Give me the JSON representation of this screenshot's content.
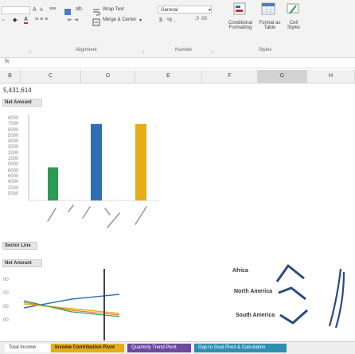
{
  "ribbon": {
    "font": {
      "grow_label": "A",
      "shrink_label": "A",
      "font_color_label": "A"
    },
    "alignment": {
      "wrap_text": "Wrap Text",
      "merge_center": "Merge & Center",
      "group_label": "Alignment"
    },
    "number": {
      "format_value": "General",
      "symbols": "$ · % ,",
      "group_label": "Number"
    },
    "styles": {
      "conditional_formatting": "Conditional Formatting",
      "format_as_table": "Format as Table",
      "cell_styles": "Cell Styles",
      "group_label": "Styles"
    }
  },
  "formula_bar": {
    "fx_label": "fx"
  },
  "columns": [
    "B",
    "C",
    "D",
    "E",
    "F",
    "G",
    "H"
  ],
  "selected_column": "G",
  "cells": {
    "b2_value": "5,431,614",
    "net_amount_header": "Net Amount",
    "sector_line_header": "Sector Line",
    "net_amount_header_2": "Net Amount"
  },
  "region_labels": [
    "Africa",
    "North America",
    "South America"
  ],
  "bar_chart": {
    "bars": [
      {
        "color": "#2e9b54",
        "value": 32
      },
      {
        "color": "#2f6eb5",
        "value": 74
      },
      {
        "color": "#e5ad19",
        "value": 74
      }
    ],
    "ymax": 80
  },
  "colors": {
    "green": "#2e9b54",
    "blue": "#2f6eb5",
    "gold": "#e5ad19",
    "navy": "#2b4b80",
    "purple": "#6b4aa0",
    "teal": "#2f8fb0"
  },
  "sheet_tabs": [
    {
      "label": "Total Income",
      "active": true
    },
    {
      "label": "Income Contribution Pivot",
      "active": false
    },
    {
      "label": "Quarterly Trend Pivot",
      "active": false
    },
    {
      "label": "Gap to Goal Pivot & Calculation",
      "active": false
    }
  ]
}
